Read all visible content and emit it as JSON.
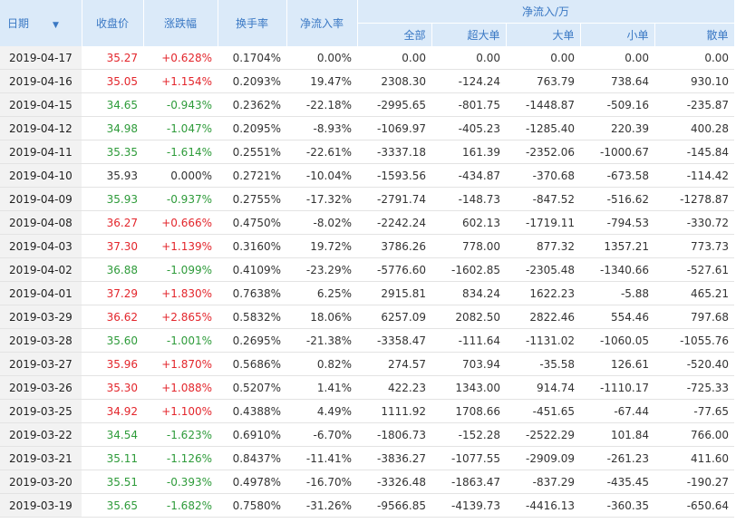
{
  "header": {
    "date": "日期",
    "close": "收盘价",
    "change": "涨跌幅",
    "turnover": "换手率",
    "net_ratio": "净流入率",
    "group": "净流入/万",
    "all": "全部",
    "xl": "超大单",
    "large": "大单",
    "medium": "小单",
    "small": "散单"
  },
  "icons": {
    "sort": "sort-down-arrow-icon"
  },
  "colors": {
    "up": "#e3262c",
    "down": "#2e9b3a",
    "header_bg": "#dbeaf9",
    "header_text": "#3a78c4"
  },
  "rows": [
    {
      "date": "2019-04-17",
      "close": "35.27",
      "change": "+0.628%",
      "dir": "up",
      "turnover": "0.1704%",
      "net_ratio": "0.00%",
      "all": "0.00",
      "xl": "0.00",
      "large": "0.00",
      "medium": "0.00",
      "small": "0.00"
    },
    {
      "date": "2019-04-16",
      "close": "35.05",
      "change": "+1.154%",
      "dir": "up",
      "turnover": "0.2093%",
      "net_ratio": "19.47%",
      "all": "2308.30",
      "xl": "-124.24",
      "large": "763.79",
      "medium": "738.64",
      "small": "930.10"
    },
    {
      "date": "2019-04-15",
      "close": "34.65",
      "change": "-0.943%",
      "dir": "down",
      "turnover": "0.2362%",
      "net_ratio": "-22.18%",
      "all": "-2995.65",
      "xl": "-801.75",
      "large": "-1448.87",
      "medium": "-509.16",
      "small": "-235.87"
    },
    {
      "date": "2019-04-12",
      "close": "34.98",
      "change": "-1.047%",
      "dir": "down",
      "turnover": "0.2095%",
      "net_ratio": "-8.93%",
      "all": "-1069.97",
      "xl": "-405.23",
      "large": "-1285.40",
      "medium": "220.39",
      "small": "400.28"
    },
    {
      "date": "2019-04-11",
      "close": "35.35",
      "change": "-1.614%",
      "dir": "down",
      "turnover": "0.2551%",
      "net_ratio": "-22.61%",
      "all": "-3337.18",
      "xl": "161.39",
      "large": "-2352.06",
      "medium": "-1000.67",
      "small": "-145.84"
    },
    {
      "date": "2019-04-10",
      "close": "35.93",
      "change": "0.000%",
      "dir": "flat",
      "turnover": "0.2721%",
      "net_ratio": "-10.04%",
      "all": "-1593.56",
      "xl": "-434.87",
      "large": "-370.68",
      "medium": "-673.58",
      "small": "-114.42"
    },
    {
      "date": "2019-04-09",
      "close": "35.93",
      "change": "-0.937%",
      "dir": "down",
      "turnover": "0.2755%",
      "net_ratio": "-17.32%",
      "all": "-2791.74",
      "xl": "-148.73",
      "large": "-847.52",
      "medium": "-516.62",
      "small": "-1278.87"
    },
    {
      "date": "2019-04-08",
      "close": "36.27",
      "change": "+0.666%",
      "dir": "up",
      "turnover": "0.4750%",
      "net_ratio": "-8.02%",
      "all": "-2242.24",
      "xl": "602.13",
      "large": "-1719.11",
      "medium": "-794.53",
      "small": "-330.72"
    },
    {
      "date": "2019-04-03",
      "close": "37.30",
      "change": "+1.139%",
      "dir": "up",
      "turnover": "0.3160%",
      "net_ratio": "19.72%",
      "all": "3786.26",
      "xl": "778.00",
      "large": "877.32",
      "medium": "1357.21",
      "small": "773.73"
    },
    {
      "date": "2019-04-02",
      "close": "36.88",
      "change": "-1.099%",
      "dir": "down",
      "turnover": "0.4109%",
      "net_ratio": "-23.29%",
      "all": "-5776.60",
      "xl": "-1602.85",
      "large": "-2305.48",
      "medium": "-1340.66",
      "small": "-527.61"
    },
    {
      "date": "2019-04-01",
      "close": "37.29",
      "change": "+1.830%",
      "dir": "up",
      "turnover": "0.7638%",
      "net_ratio": "6.25%",
      "all": "2915.81",
      "xl": "834.24",
      "large": "1622.23",
      "medium": "-5.88",
      "small": "465.21"
    },
    {
      "date": "2019-03-29",
      "close": "36.62",
      "change": "+2.865%",
      "dir": "up",
      "turnover": "0.5832%",
      "net_ratio": "18.06%",
      "all": "6257.09",
      "xl": "2082.50",
      "large": "2822.46",
      "medium": "554.46",
      "small": "797.68"
    },
    {
      "date": "2019-03-28",
      "close": "35.60",
      "change": "-1.001%",
      "dir": "down",
      "turnover": "0.2695%",
      "net_ratio": "-21.38%",
      "all": "-3358.47",
      "xl": "-111.64",
      "large": "-1131.02",
      "medium": "-1060.05",
      "small": "-1055.76"
    },
    {
      "date": "2019-03-27",
      "close": "35.96",
      "change": "+1.870%",
      "dir": "up",
      "turnover": "0.5686%",
      "net_ratio": "0.82%",
      "all": "274.57",
      "xl": "703.94",
      "large": "-35.58",
      "medium": "126.61",
      "small": "-520.40"
    },
    {
      "date": "2019-03-26",
      "close": "35.30",
      "change": "+1.088%",
      "dir": "up",
      "turnover": "0.5207%",
      "net_ratio": "1.41%",
      "all": "422.23",
      "xl": "1343.00",
      "large": "914.74",
      "medium": "-1110.17",
      "small": "-725.33"
    },
    {
      "date": "2019-03-25",
      "close": "34.92",
      "change": "+1.100%",
      "dir": "up",
      "turnover": "0.4388%",
      "net_ratio": "4.49%",
      "all": "1111.92",
      "xl": "1708.66",
      "large": "-451.65",
      "medium": "-67.44",
      "small": "-77.65"
    },
    {
      "date": "2019-03-22",
      "close": "34.54",
      "change": "-1.623%",
      "dir": "down",
      "turnover": "0.6910%",
      "net_ratio": "-6.70%",
      "all": "-1806.73",
      "xl": "-152.28",
      "large": "-2522.29",
      "medium": "101.84",
      "small": "766.00"
    },
    {
      "date": "2019-03-21",
      "close": "35.11",
      "change": "-1.126%",
      "dir": "down",
      "turnover": "0.8437%",
      "net_ratio": "-11.41%",
      "all": "-3836.27",
      "xl": "-1077.55",
      "large": "-2909.09",
      "medium": "-261.23",
      "small": "411.60"
    },
    {
      "date": "2019-03-20",
      "close": "35.51",
      "change": "-0.393%",
      "dir": "down",
      "turnover": "0.4978%",
      "net_ratio": "-16.70%",
      "all": "-3326.48",
      "xl": "-1863.47",
      "large": "-837.29",
      "medium": "-435.45",
      "small": "-190.27"
    },
    {
      "date": "2019-03-19",
      "close": "35.65",
      "change": "-1.682%",
      "dir": "down",
      "turnover": "0.7580%",
      "net_ratio": "-31.26%",
      "all": "-9566.85",
      "xl": "-4139.73",
      "large": "-4416.13",
      "medium": "-360.35",
      "small": "-650.64"
    }
  ]
}
